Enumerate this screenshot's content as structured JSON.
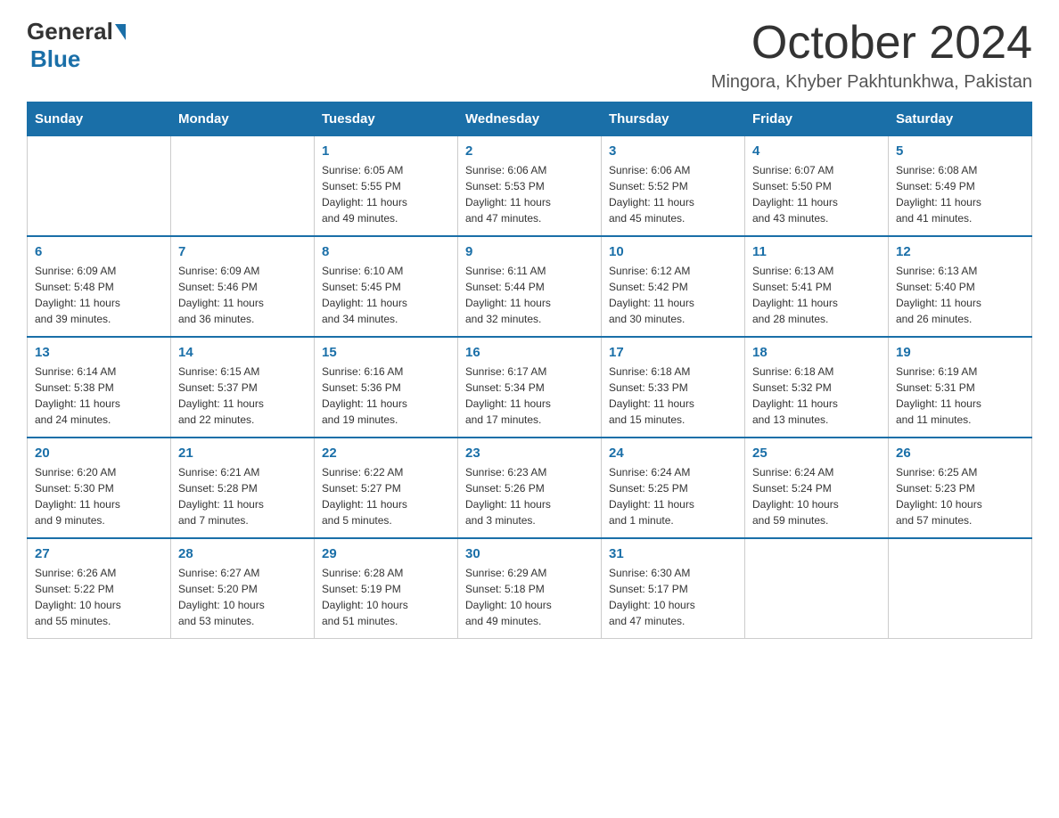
{
  "logo": {
    "general": "General",
    "blue": "Blue"
  },
  "header": {
    "month": "October 2024",
    "location": "Mingora, Khyber Pakhtunkhwa, Pakistan"
  },
  "weekdays": [
    "Sunday",
    "Monday",
    "Tuesday",
    "Wednesday",
    "Thursday",
    "Friday",
    "Saturday"
  ],
  "weeks": [
    [
      {
        "day": "",
        "info": ""
      },
      {
        "day": "",
        "info": ""
      },
      {
        "day": "1",
        "info": "Sunrise: 6:05 AM\nSunset: 5:55 PM\nDaylight: 11 hours\nand 49 minutes."
      },
      {
        "day": "2",
        "info": "Sunrise: 6:06 AM\nSunset: 5:53 PM\nDaylight: 11 hours\nand 47 minutes."
      },
      {
        "day": "3",
        "info": "Sunrise: 6:06 AM\nSunset: 5:52 PM\nDaylight: 11 hours\nand 45 minutes."
      },
      {
        "day": "4",
        "info": "Sunrise: 6:07 AM\nSunset: 5:50 PM\nDaylight: 11 hours\nand 43 minutes."
      },
      {
        "day": "5",
        "info": "Sunrise: 6:08 AM\nSunset: 5:49 PM\nDaylight: 11 hours\nand 41 minutes."
      }
    ],
    [
      {
        "day": "6",
        "info": "Sunrise: 6:09 AM\nSunset: 5:48 PM\nDaylight: 11 hours\nand 39 minutes."
      },
      {
        "day": "7",
        "info": "Sunrise: 6:09 AM\nSunset: 5:46 PM\nDaylight: 11 hours\nand 36 minutes."
      },
      {
        "day": "8",
        "info": "Sunrise: 6:10 AM\nSunset: 5:45 PM\nDaylight: 11 hours\nand 34 minutes."
      },
      {
        "day": "9",
        "info": "Sunrise: 6:11 AM\nSunset: 5:44 PM\nDaylight: 11 hours\nand 32 minutes."
      },
      {
        "day": "10",
        "info": "Sunrise: 6:12 AM\nSunset: 5:42 PM\nDaylight: 11 hours\nand 30 minutes."
      },
      {
        "day": "11",
        "info": "Sunrise: 6:13 AM\nSunset: 5:41 PM\nDaylight: 11 hours\nand 28 minutes."
      },
      {
        "day": "12",
        "info": "Sunrise: 6:13 AM\nSunset: 5:40 PM\nDaylight: 11 hours\nand 26 minutes."
      }
    ],
    [
      {
        "day": "13",
        "info": "Sunrise: 6:14 AM\nSunset: 5:38 PM\nDaylight: 11 hours\nand 24 minutes."
      },
      {
        "day": "14",
        "info": "Sunrise: 6:15 AM\nSunset: 5:37 PM\nDaylight: 11 hours\nand 22 minutes."
      },
      {
        "day": "15",
        "info": "Sunrise: 6:16 AM\nSunset: 5:36 PM\nDaylight: 11 hours\nand 19 minutes."
      },
      {
        "day": "16",
        "info": "Sunrise: 6:17 AM\nSunset: 5:34 PM\nDaylight: 11 hours\nand 17 minutes."
      },
      {
        "day": "17",
        "info": "Sunrise: 6:18 AM\nSunset: 5:33 PM\nDaylight: 11 hours\nand 15 minutes."
      },
      {
        "day": "18",
        "info": "Sunrise: 6:18 AM\nSunset: 5:32 PM\nDaylight: 11 hours\nand 13 minutes."
      },
      {
        "day": "19",
        "info": "Sunrise: 6:19 AM\nSunset: 5:31 PM\nDaylight: 11 hours\nand 11 minutes."
      }
    ],
    [
      {
        "day": "20",
        "info": "Sunrise: 6:20 AM\nSunset: 5:30 PM\nDaylight: 11 hours\nand 9 minutes."
      },
      {
        "day": "21",
        "info": "Sunrise: 6:21 AM\nSunset: 5:28 PM\nDaylight: 11 hours\nand 7 minutes."
      },
      {
        "day": "22",
        "info": "Sunrise: 6:22 AM\nSunset: 5:27 PM\nDaylight: 11 hours\nand 5 minutes."
      },
      {
        "day": "23",
        "info": "Sunrise: 6:23 AM\nSunset: 5:26 PM\nDaylight: 11 hours\nand 3 minutes."
      },
      {
        "day": "24",
        "info": "Sunrise: 6:24 AM\nSunset: 5:25 PM\nDaylight: 11 hours\nand 1 minute."
      },
      {
        "day": "25",
        "info": "Sunrise: 6:24 AM\nSunset: 5:24 PM\nDaylight: 10 hours\nand 59 minutes."
      },
      {
        "day": "26",
        "info": "Sunrise: 6:25 AM\nSunset: 5:23 PM\nDaylight: 10 hours\nand 57 minutes."
      }
    ],
    [
      {
        "day": "27",
        "info": "Sunrise: 6:26 AM\nSunset: 5:22 PM\nDaylight: 10 hours\nand 55 minutes."
      },
      {
        "day": "28",
        "info": "Sunrise: 6:27 AM\nSunset: 5:20 PM\nDaylight: 10 hours\nand 53 minutes."
      },
      {
        "day": "29",
        "info": "Sunrise: 6:28 AM\nSunset: 5:19 PM\nDaylight: 10 hours\nand 51 minutes."
      },
      {
        "day": "30",
        "info": "Sunrise: 6:29 AM\nSunset: 5:18 PM\nDaylight: 10 hours\nand 49 minutes."
      },
      {
        "day": "31",
        "info": "Sunrise: 6:30 AM\nSunset: 5:17 PM\nDaylight: 10 hours\nand 47 minutes."
      },
      {
        "day": "",
        "info": ""
      },
      {
        "day": "",
        "info": ""
      }
    ]
  ]
}
